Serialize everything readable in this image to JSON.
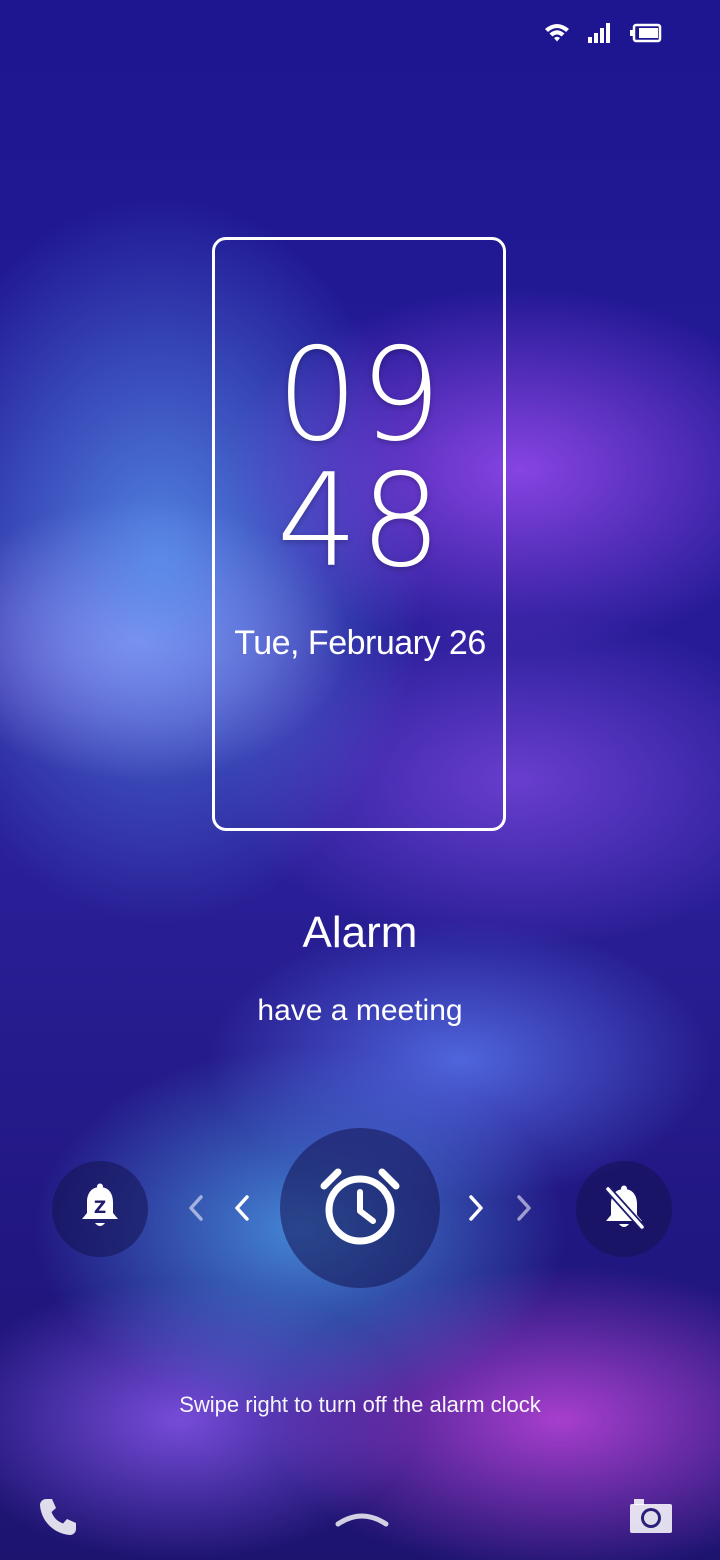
{
  "status_bar": {
    "icons": [
      "wifi-icon",
      "signal-icon",
      "battery-icon"
    ]
  },
  "clock": {
    "hours": "09",
    "minutes": "48",
    "date": "Tue, February 26"
  },
  "alarm": {
    "title": "Alarm",
    "label": "have a meeting",
    "swipe_hint": "Swipe right to turn off the alarm clock"
  },
  "controls": {
    "snooze_icon": "snooze-bell-icon",
    "center_icon": "alarm-clock-icon",
    "dismiss_icon": "bell-off-icon"
  },
  "bottom_bar": {
    "icons": [
      "phone-icon",
      "swipe-up-handle-icon",
      "camera-icon"
    ]
  }
}
